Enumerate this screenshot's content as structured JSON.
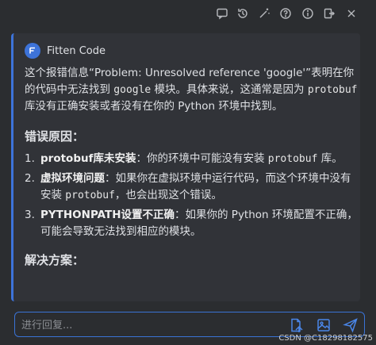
{
  "toolbar": {
    "icons": [
      "chat-icon",
      "history-icon",
      "magic-wand-icon",
      "help-icon",
      "info-icon",
      "export-icon",
      "close-panel-icon"
    ]
  },
  "chat": {
    "brand": "Fitten Code",
    "intro_a": "这个报错信息“Problem: Unresolved reference 'google'”表明在你的代码中无法找到 ",
    "intro_code1": "google",
    "intro_b": " 模块。具体来说，这通常是因为 ",
    "intro_code2": "protobuf",
    "intro_c": " 库没有正确安装或者没有在你的 Python 环境中找到。",
    "section1_title": "错误原因：",
    "reasons": [
      {
        "num": "1.",
        "title": "protobuf库未安装",
        "text_a": "：你的环境中可能没有安装 ",
        "code": "protobuf",
        "text_b": " 库。"
      },
      {
        "num": "2.",
        "title": "虚拟环境问题",
        "text_a": "：如果你在虚拟环境中运行代码，而这个环境中没有安装 ",
        "code": "protobuf",
        "text_b": "，也会出现这个错误。"
      },
      {
        "num": "3.",
        "title": "PYTHONPATH设置不正确",
        "text_a": "：如果你的 Python 环境配置不正确，可能会导致无法找到相应的模块。",
        "code": "",
        "text_b": ""
      }
    ],
    "section2_title": "解决方案："
  },
  "input": {
    "placeholder": "进行回复...",
    "icons": [
      "insert-file-icon",
      "insert-image-icon",
      "send-icon"
    ]
  },
  "watermark": "CSDN @C18298182575",
  "colors": {
    "accent": "#3d73d9",
    "panel": "#313338",
    "background": "#2b2d30"
  }
}
